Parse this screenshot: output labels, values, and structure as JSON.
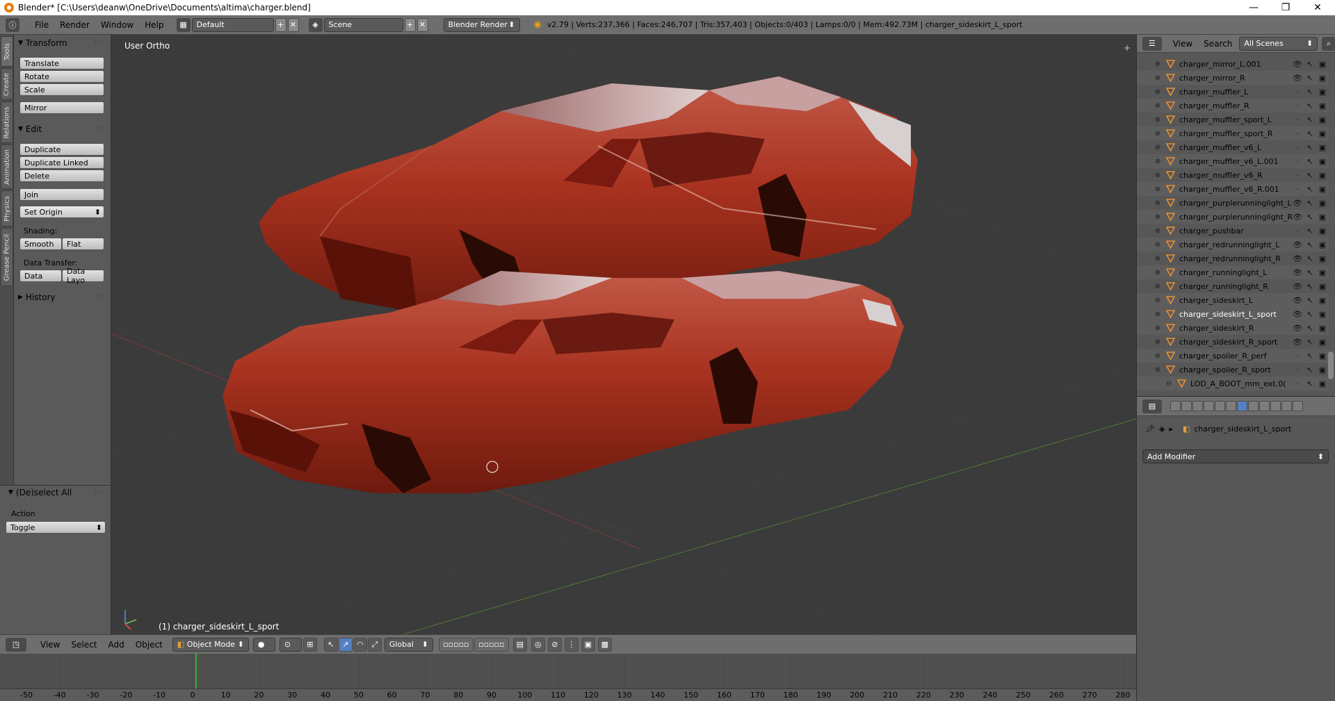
{
  "window": {
    "title": "Blender* [C:\\Users\\deanw\\OneDrive\\Documents\\altima\\charger.blend]",
    "minimize": "—",
    "maximize": "❐",
    "close": "✕"
  },
  "info_header": {
    "menu": [
      "File",
      "Render",
      "Window",
      "Help"
    ],
    "layout": "Default",
    "scene": "Scene",
    "render_engine": "Blender Render",
    "stats": "v2.79 | Verts:237,366 | Faces:246,707 | Tris:357,403 | Objects:0/403 | Lamps:0/0 | Mem:492.73M | charger_sideskirt_L_sport"
  },
  "vertical_tabs": [
    "Tools",
    "Create",
    "Relations",
    "Animation",
    "Physics",
    "Grease Pencil"
  ],
  "tool_shelf": {
    "transform_header": "Transform",
    "transform_buttons": [
      "Translate",
      "Rotate",
      "Scale"
    ],
    "mirror": "Mirror",
    "edit_header": "Edit",
    "edit_buttons": [
      "Duplicate",
      "Duplicate Linked",
      "Delete"
    ],
    "join": "Join",
    "set_origin": "Set Origin",
    "shading_label": "Shading:",
    "smooth": "Smooth",
    "flat": "Flat",
    "data_transfer_label": "Data Transfer:",
    "data": "Data",
    "data_layout": "Data Layo",
    "history_header": "History"
  },
  "redo_panel": {
    "header": "(De)select All",
    "action_label": "Action",
    "action_value": "Toggle"
  },
  "viewport": {
    "view_label": "User Ortho",
    "active_object": "(1) charger_sideskirt_L_sport",
    "car_color": "#a8321f"
  },
  "viewport_header": {
    "menu": [
      "View",
      "Select",
      "Add",
      "Object"
    ],
    "mode": "Object Mode",
    "orientation": "Global"
  },
  "timeline": {
    "ticks": [
      -50,
      -40,
      -30,
      -20,
      -10,
      0,
      10,
      20,
      30,
      40,
      50,
      60,
      70,
      80,
      90,
      100,
      110,
      120,
      130,
      140,
      150,
      160,
      170,
      180,
      190,
      200,
      210,
      220,
      230,
      240,
      250,
      260,
      270,
      280
    ],
    "current_frame": 1
  },
  "outliner": {
    "view": "View",
    "search": "Search",
    "filter": "All Scenes",
    "items": [
      {
        "name": "charger_mirror_L.001",
        "visible": true
      },
      {
        "name": "charger_mirror_R",
        "visible": true
      },
      {
        "name": "charger_muffler_L",
        "visible": false
      },
      {
        "name": "charger_muffler_R",
        "visible": false
      },
      {
        "name": "charger_muffler_sport_L",
        "visible": false
      },
      {
        "name": "charger_muffler_sport_R",
        "visible": false
      },
      {
        "name": "charger_muffler_v6_L",
        "visible": false
      },
      {
        "name": "charger_muffler_v6_L.001",
        "visible": false
      },
      {
        "name": "charger_muffler_v6_R",
        "visible": false
      },
      {
        "name": "charger_muffler_v6_R.001",
        "visible": false
      },
      {
        "name": "charger_purplerunninglight_L",
        "visible": true
      },
      {
        "name": "charger_purplerunninglight_R",
        "visible": true
      },
      {
        "name": "charger_pushbar",
        "visible": false
      },
      {
        "name": "charger_redrunninglight_L",
        "visible": true
      },
      {
        "name": "charger_redrunninglight_R",
        "visible": true
      },
      {
        "name": "charger_runninglight_L",
        "visible": true
      },
      {
        "name": "charger_runninglight_R",
        "visible": true
      },
      {
        "name": "charger_sideskirt_L",
        "visible": true
      },
      {
        "name": "charger_sideskirt_L_sport",
        "visible": true,
        "selected": true
      },
      {
        "name": "charger_sideskirt_R",
        "visible": true
      },
      {
        "name": "charger_sideskirt_R_sport",
        "visible": true
      },
      {
        "name": "charger_spoiler_R_perf",
        "visible": false
      },
      {
        "name": "charger_spoiler_R_sport",
        "visible": false
      },
      {
        "name": "LOD_A_BOOT_mm_ext.0(",
        "visible": false,
        "child": true
      }
    ]
  },
  "properties": {
    "object_name": "charger_sideskirt_L_sport",
    "add_modifier": "Add Modifier"
  }
}
